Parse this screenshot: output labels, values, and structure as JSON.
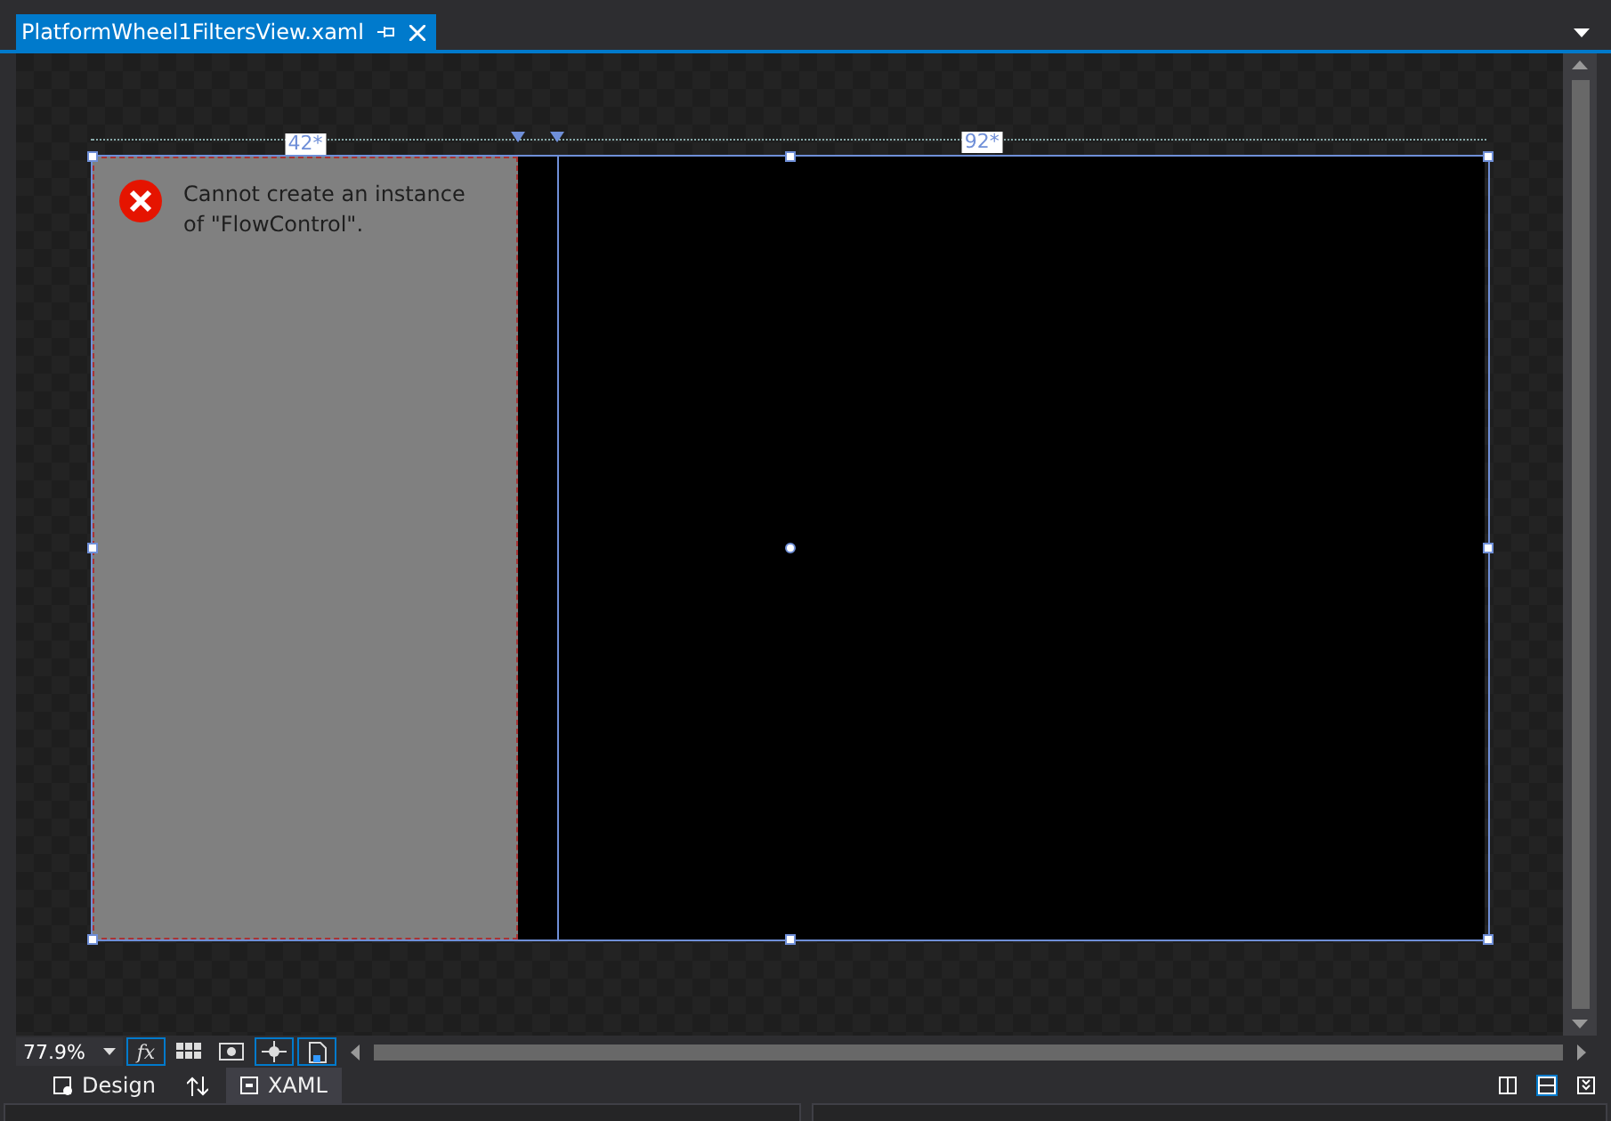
{
  "document_tab": {
    "title": "PlatformWheel1FiltersView.xaml",
    "pinned": false
  },
  "canvas": {
    "columns": [
      {
        "label": "42*",
        "error": {
          "message": "Cannot create an instance of \"FlowControl\"."
        }
      },
      {
        "label": "92*"
      }
    ]
  },
  "toolbar": {
    "zoom": "77.9%",
    "buttons": [
      {
        "kind": "fx",
        "label": "fx",
        "selected": true
      },
      {
        "kind": "grid",
        "selected": false
      },
      {
        "kind": "snapgrid",
        "selected": false
      },
      {
        "kind": "snaplines",
        "selected": true
      },
      {
        "kind": "artboard",
        "selected": true
      }
    ]
  },
  "view_tabs": [
    {
      "label": "Design",
      "kind": "design",
      "selected": false
    },
    {
      "label": "XAML",
      "kind": "xaml",
      "selected": true
    }
  ],
  "pane_buttons": [
    {
      "kind": "vertical",
      "selected": false
    },
    {
      "kind": "horizontal",
      "selected": true
    },
    {
      "kind": "collapse",
      "selected": false
    }
  ]
}
